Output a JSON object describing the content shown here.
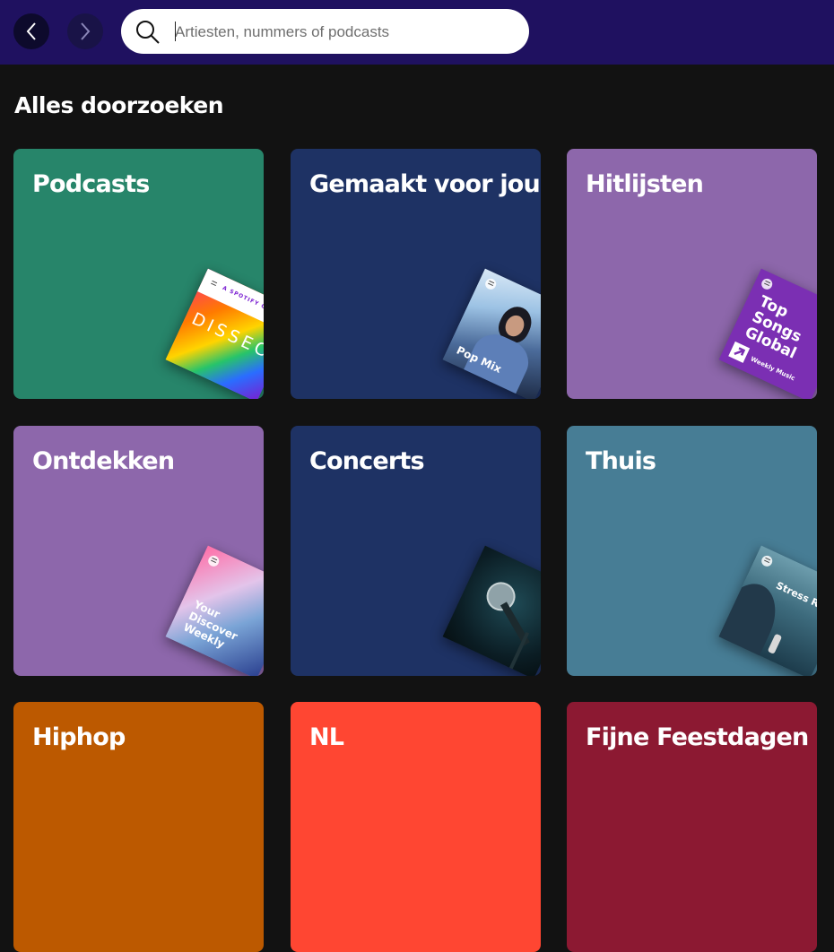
{
  "search": {
    "placeholder": "Artiesten, nummers of podcasts"
  },
  "heading": "Alles doorzoeken",
  "cards": [
    {
      "title": "Podcasts",
      "color": "#27856a",
      "cover": "DISSECT",
      "cover_sub": "A SPOTIFY ORIG"
    },
    {
      "title": "Gemaakt voor jou",
      "color": "#1e3264",
      "cover": "Pop Mix"
    },
    {
      "title": "Hitlijsten",
      "color": "#8d67ab",
      "cover": "Top Songs Global",
      "cover_sub": "Weekly Music"
    },
    {
      "title": "Ontdekken",
      "color": "#8d67ab",
      "cover": "Your Discover Weekly"
    },
    {
      "title": "Concerts",
      "color": "#1e3264",
      "cover": ""
    },
    {
      "title": "Thuis",
      "color": "#477d95",
      "cover": "Stress Relief"
    },
    {
      "title": "Hiphop",
      "color": "#bc5900",
      "cover": ""
    },
    {
      "title": "NL",
      "color": "#ff4632",
      "cover": ""
    },
    {
      "title": "Fijne Feestdagen",
      "color": "#8c1932",
      "cover": ""
    }
  ]
}
